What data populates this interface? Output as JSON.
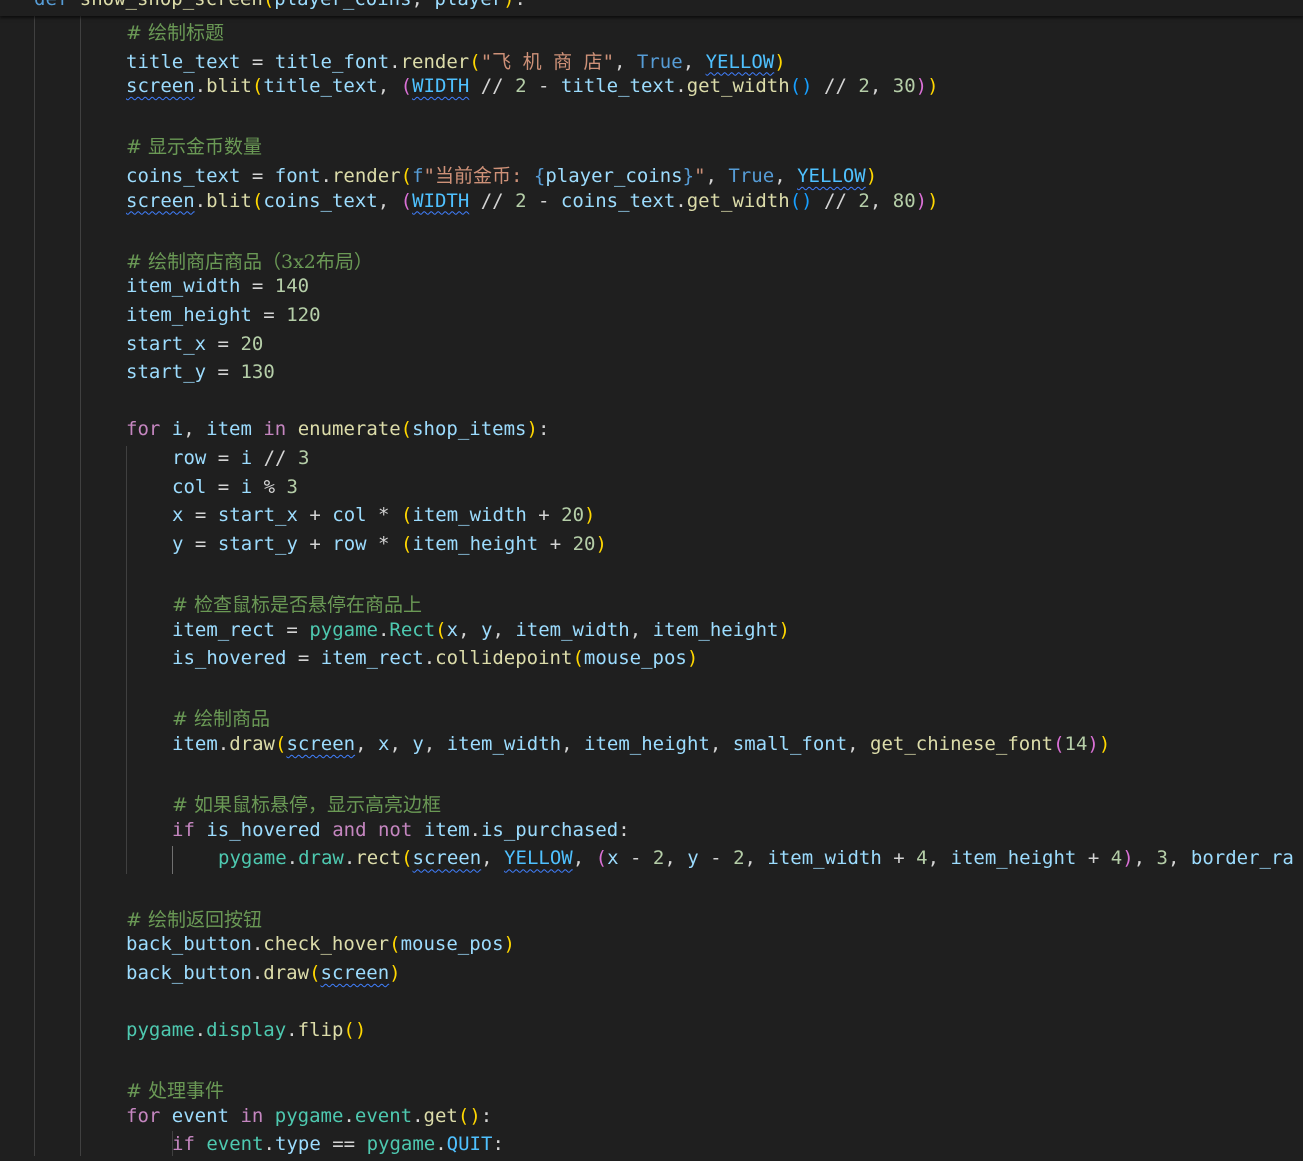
{
  "editor": {
    "language": "python",
    "sticky_header": "def show_shop_screen(player_coins, player):",
    "lines": [
      {
        "indent": 1,
        "text": "# 绘制标题"
      },
      {
        "indent": 1,
        "text": "title_text = title_font.render(\"飞 机 商 店\", True, YELLOW)"
      },
      {
        "indent": 1,
        "text": "screen.blit(title_text, (WIDTH // 2 - title_text.get_width() // 2, 30))"
      },
      {
        "indent": 1,
        "text": ""
      },
      {
        "indent": 1,
        "text": "# 显示金币数量"
      },
      {
        "indent": 1,
        "text": "coins_text = font.render(f\"当前金币: {player_coins}\", True, YELLOW)"
      },
      {
        "indent": 1,
        "text": "screen.blit(coins_text, (WIDTH // 2 - coins_text.get_width() // 2, 80))"
      },
      {
        "indent": 1,
        "text": ""
      },
      {
        "indent": 1,
        "text": "# 绘制商店商品（3x2布局）"
      },
      {
        "indent": 1,
        "text": "item_width = 140"
      },
      {
        "indent": 1,
        "text": "item_height = 120"
      },
      {
        "indent": 1,
        "text": "start_x = 20"
      },
      {
        "indent": 1,
        "text": "start_y = 130"
      },
      {
        "indent": 1,
        "text": ""
      },
      {
        "indent": 1,
        "text": "for i, item in enumerate(shop_items):"
      },
      {
        "indent": 2,
        "text": "row = i // 3"
      },
      {
        "indent": 2,
        "text": "col = i % 3"
      },
      {
        "indent": 2,
        "text": "x = start_x + col * (item_width + 20)"
      },
      {
        "indent": 2,
        "text": "y = start_y + row * (item_height + 20)"
      },
      {
        "indent": 2,
        "text": ""
      },
      {
        "indent": 2,
        "text": "# 检查鼠标是否悬停在商品上"
      },
      {
        "indent": 2,
        "text": "item_rect = pygame.Rect(x, y, item_width, item_height)"
      },
      {
        "indent": 2,
        "text": "is_hovered = item_rect.collidepoint(mouse_pos)"
      },
      {
        "indent": 2,
        "text": ""
      },
      {
        "indent": 2,
        "text": "# 绘制商品"
      },
      {
        "indent": 2,
        "text": "item.draw(screen, x, y, item_width, item_height, small_font, get_chinese_font(14))"
      },
      {
        "indent": 2,
        "text": ""
      },
      {
        "indent": 2,
        "text": "# 如果鼠标悬停，显示高亮边框"
      },
      {
        "indent": 2,
        "text": "if is_hovered and not item.is_purchased:"
      },
      {
        "indent": 3,
        "text": "pygame.draw.rect(screen, YELLOW, (x - 2, y - 2, item_width + 4, item_height + 4), 3, border_ra"
      },
      {
        "indent": 1,
        "text": ""
      },
      {
        "indent": 1,
        "text": "# 绘制返回按钮"
      },
      {
        "indent": 1,
        "text": "back_button.check_hover(mouse_pos)"
      },
      {
        "indent": 1,
        "text": "back_button.draw(screen)"
      },
      {
        "indent": 1,
        "text": ""
      },
      {
        "indent": 1,
        "text": "pygame.display.flip()"
      },
      {
        "indent": 1,
        "text": ""
      },
      {
        "indent": 1,
        "text": "# 处理事件"
      },
      {
        "indent": 1,
        "text": "for event in pygame.event.get():"
      },
      {
        "indent": 2,
        "text": "if event.type == pygame.QUIT:"
      }
    ]
  },
  "colors": {
    "background": "#1f1f1f",
    "keyword": "#c586c0",
    "function": "#dcdcaa",
    "variable": "#9cdcfe",
    "constant": "#4fc1ff",
    "class": "#4ec9b0",
    "string": "#ce9178",
    "number": "#b5cea8",
    "comment": "#6a9955"
  },
  "warnings_underlined": [
    "screen",
    "WIDTH",
    "YELLOW"
  ]
}
